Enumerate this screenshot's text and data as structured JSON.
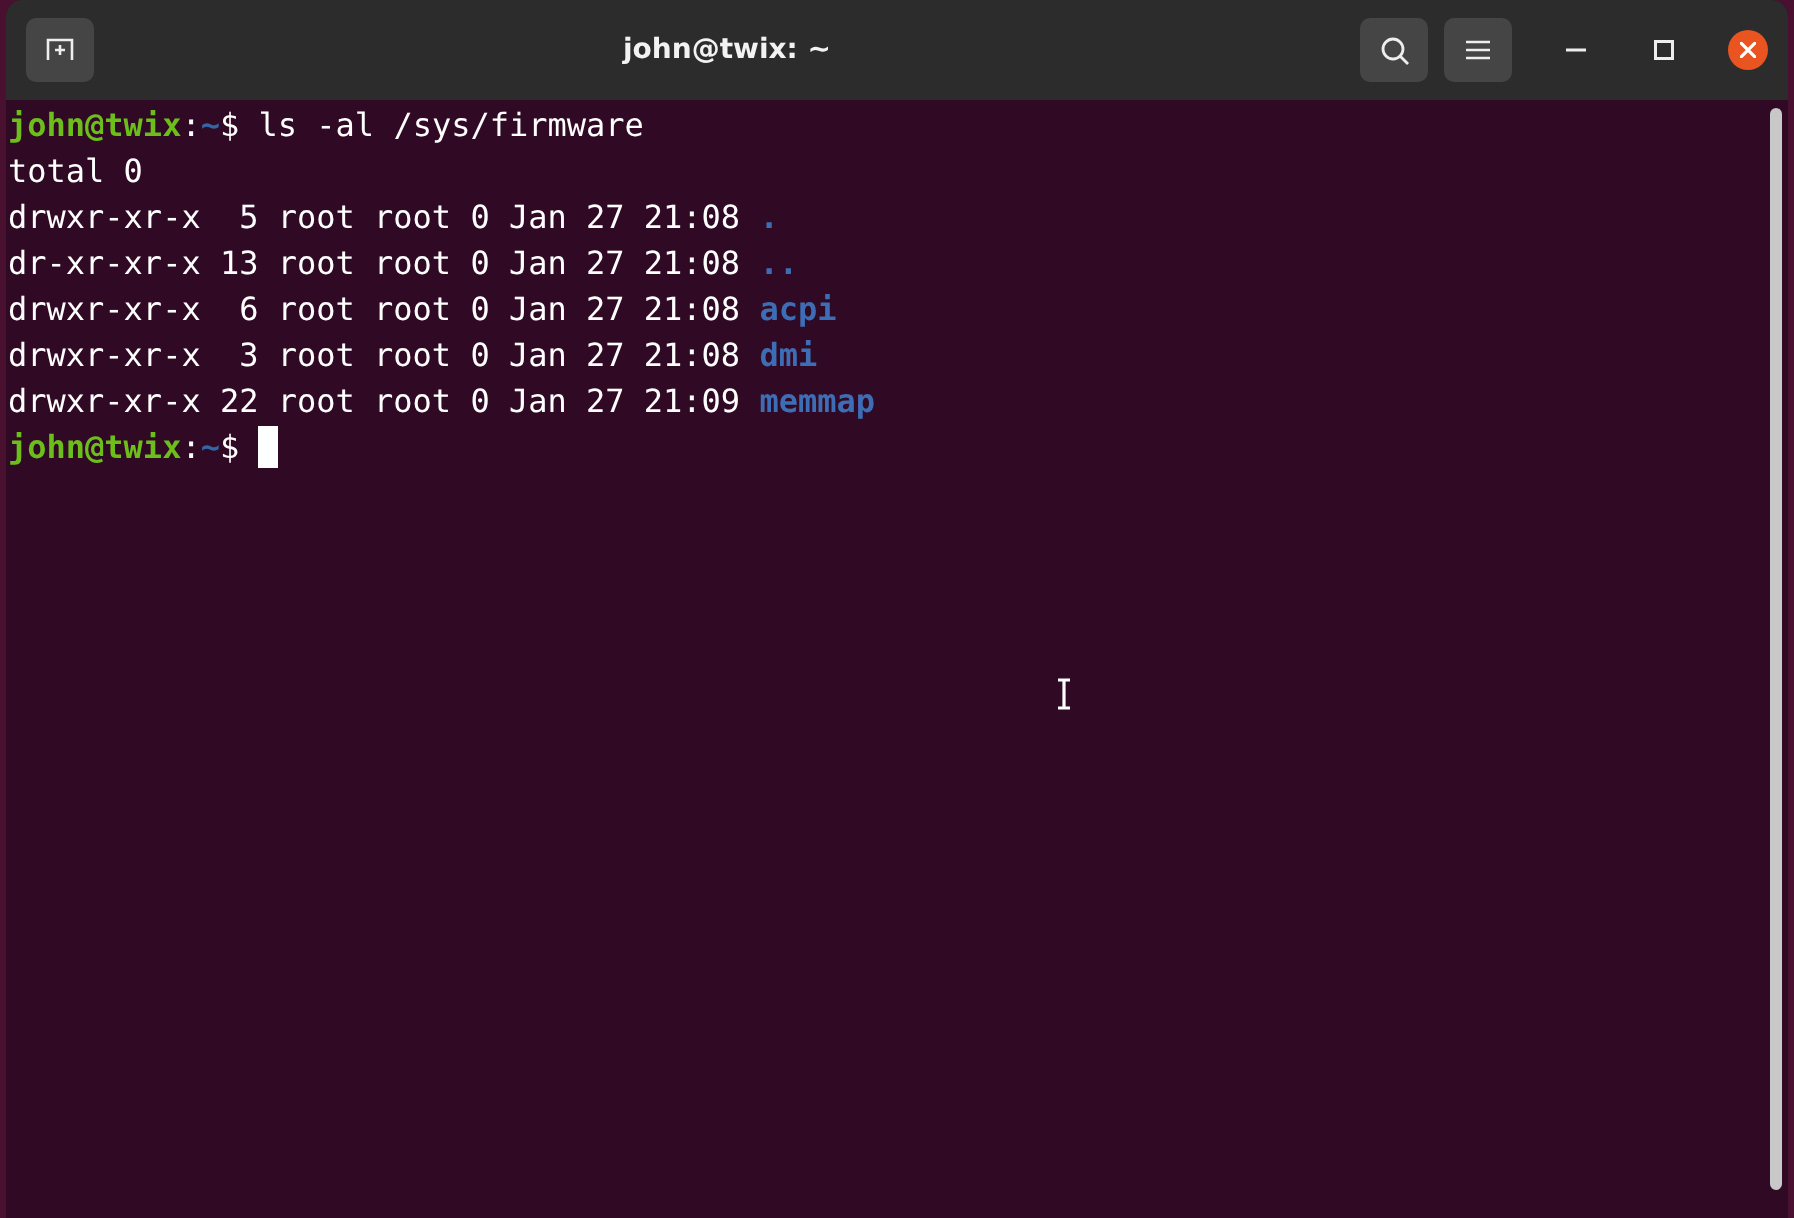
{
  "window": {
    "title": "john@twix: ~"
  },
  "lines": [
    {
      "kind": "prompt",
      "user_host": "john@twix",
      "separator": ":",
      "path": "~",
      "symbol": "$",
      "command": "ls -al /sys/firmware",
      "cursor": false
    },
    {
      "kind": "output",
      "text": "total 0"
    },
    {
      "kind": "listing",
      "text": "drwxr-xr-x  5 root root 0 Jan 27 21:08",
      "name": "."
    },
    {
      "kind": "listing",
      "text": "dr-xr-xr-x 13 root root 0 Jan 27 21:08",
      "name": ".."
    },
    {
      "kind": "listing",
      "text": "drwxr-xr-x  6 root root 0 Jan 27 21:08",
      "name": "acpi"
    },
    {
      "kind": "listing",
      "text": "drwxr-xr-x  3 root root 0 Jan 27 21:08",
      "name": "dmi"
    },
    {
      "kind": "listing",
      "text": "drwxr-xr-x 22 root root 0 Jan 27 21:09",
      "name": "memmap"
    },
    {
      "kind": "prompt",
      "user_host": "john@twix",
      "separator": ":",
      "path": "~",
      "symbol": "$",
      "cursor": true
    }
  ]
}
